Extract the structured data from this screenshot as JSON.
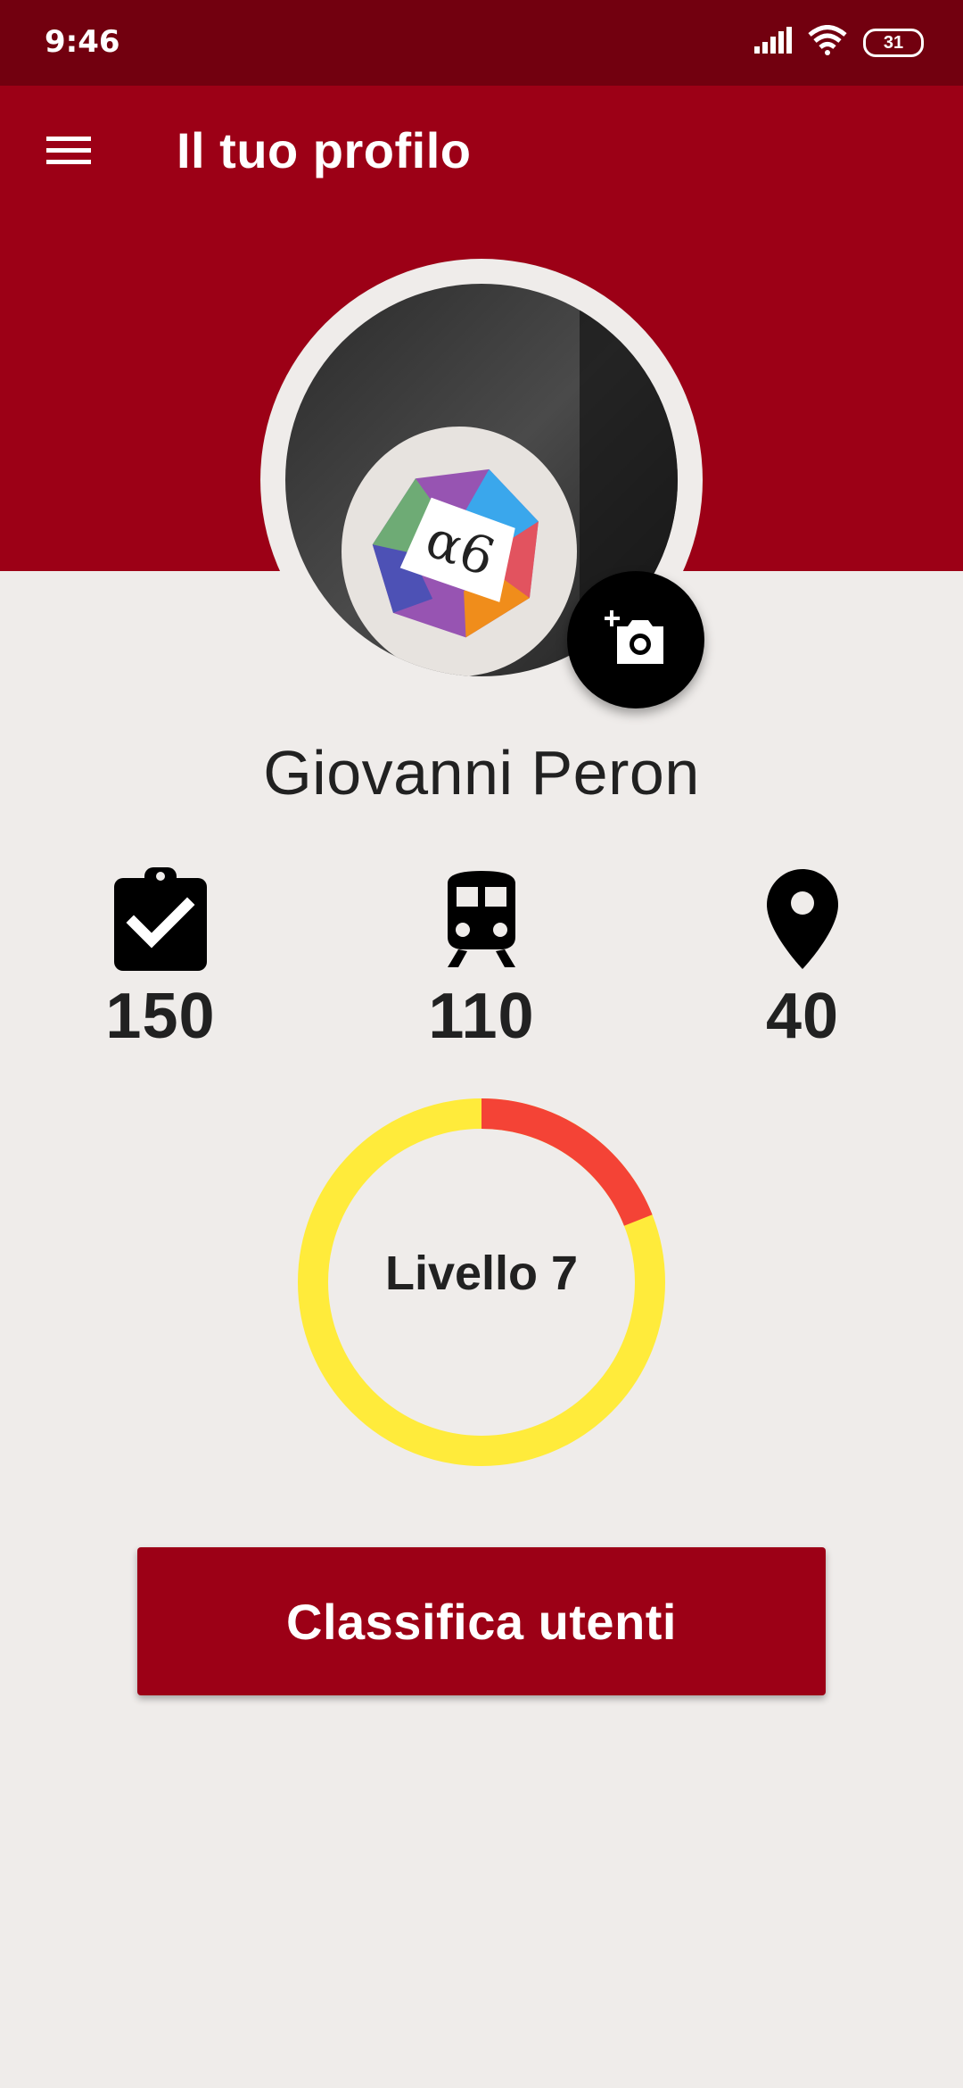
{
  "status_bar": {
    "time": "9:46",
    "battery": "31",
    "icons": [
      "signal-icon",
      "wifi-icon",
      "battery-icon"
    ]
  },
  "app_bar": {
    "title": "Il tuo profilo",
    "menu_icon": "menu-icon",
    "background_color": "#9c0016"
  },
  "profile": {
    "name": "Giovanni Peron",
    "photo_button_icon": "add-photo-icon"
  },
  "stats": [
    {
      "icon": "clipboard-check-icon",
      "value": "150"
    },
    {
      "icon": "train-icon",
      "value": "110"
    },
    {
      "icon": "location-pin-icon",
      "value": "40"
    }
  ],
  "level": {
    "label": "Livello 7",
    "progress_fraction": 0.19,
    "progress_color": "#f44336",
    "track_color": "#ffeb3b"
  },
  "actions": {
    "leaderboard_label": "Classifica utenti"
  }
}
